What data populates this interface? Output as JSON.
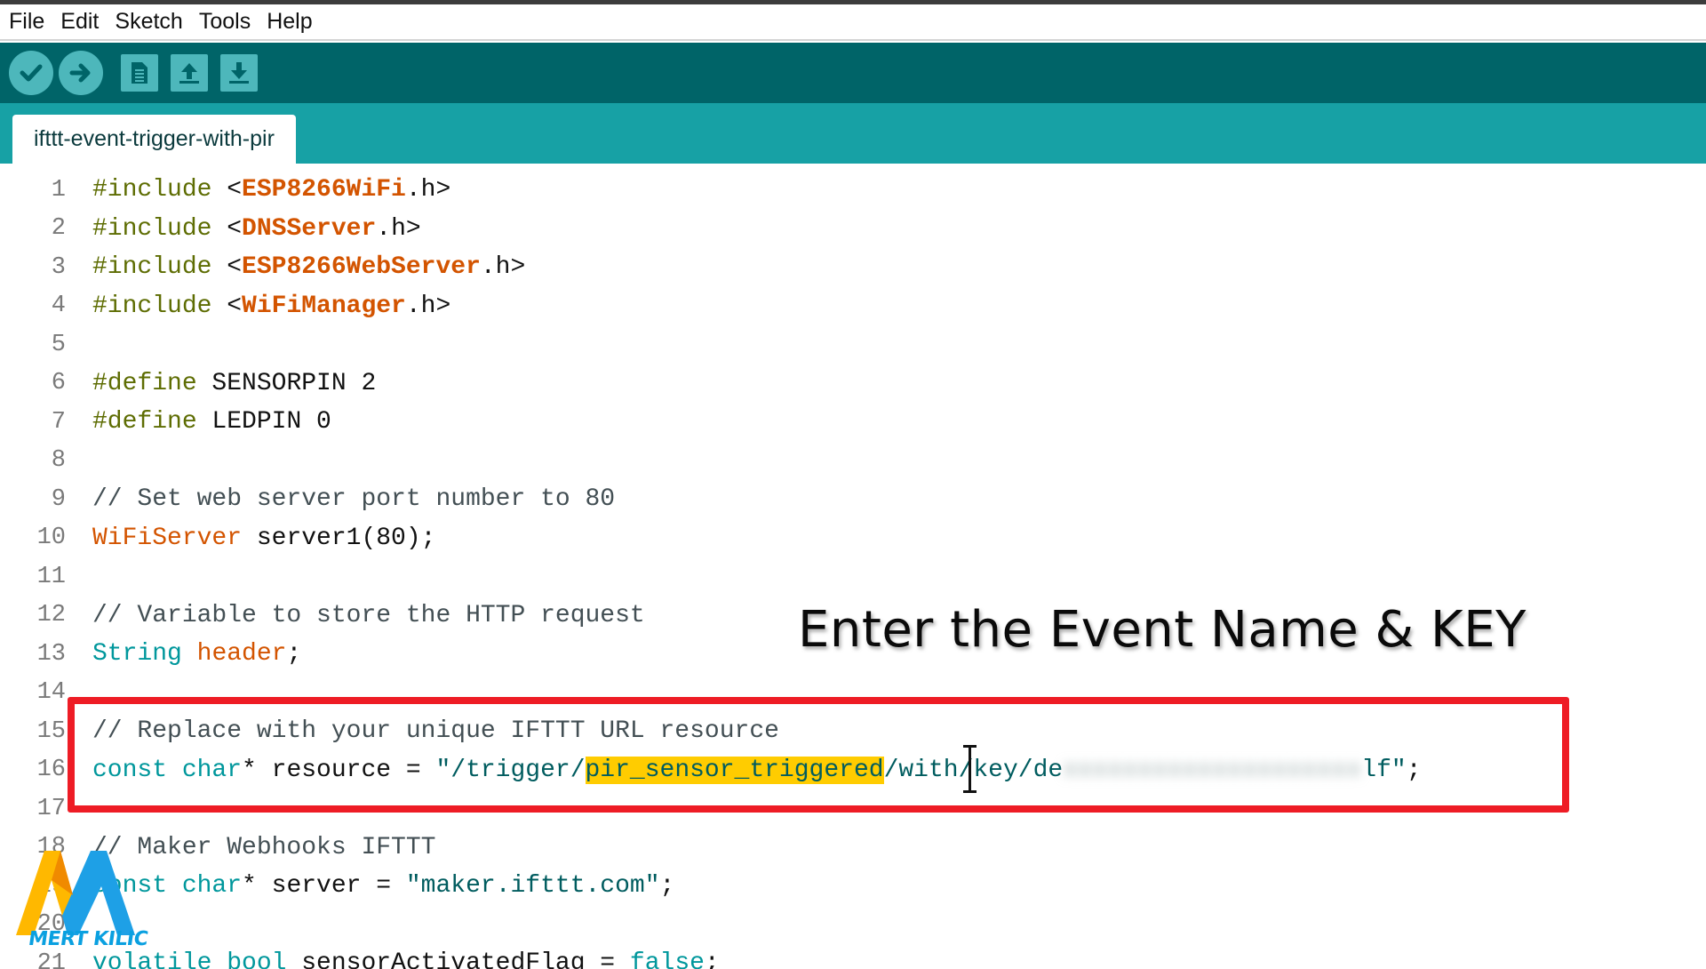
{
  "menu": [
    "File",
    "Edit",
    "Sketch",
    "Tools",
    "Help"
  ],
  "toolbar": {
    "verify_icon": "check-icon",
    "upload_icon": "arrow-right-icon",
    "new_icon": "new-file-icon",
    "open_icon": "open-arrow-up-icon",
    "save_icon": "save-arrow-down-icon"
  },
  "tab": {
    "label": "ifttt-event-trigger-with-pir"
  },
  "lines": {
    "l1": {
      "n": "1",
      "kw": "#include",
      "sp": " <",
      "lib": "ESP8266WiFi",
      "rest": ".h>"
    },
    "l2": {
      "n": "2",
      "kw": "#include",
      "sp": " <",
      "lib": "DNSServer",
      "rest": ".h>"
    },
    "l3": {
      "n": "3",
      "kw": "#include",
      "sp": " <",
      "lib": "ESP8266WebServer",
      "rest": ".h>"
    },
    "l4": {
      "n": "4",
      "kw": "#include",
      "sp": " <",
      "lib": "WiFiManager",
      "rest": ".h>"
    },
    "l5": {
      "n": "5"
    },
    "l6": {
      "n": "6",
      "kw": "#define",
      "rest": " SENSORPIN 2"
    },
    "l7": {
      "n": "7",
      "kw": "#define",
      "rest": " LEDPIN 0"
    },
    "l8": {
      "n": "8"
    },
    "l9": {
      "n": "9",
      "cmt": "// Set web server port number to 80"
    },
    "l10": {
      "n": "10",
      "cls": "WiFiServer",
      "rest": " server1(80);"
    },
    "l11": {
      "n": "11"
    },
    "l12": {
      "n": "12",
      "cmt": "// Variable to store the HTTP request"
    },
    "l13": {
      "n": "13",
      "type": "String",
      "sp": " ",
      "cls": "header",
      "rest": ";"
    },
    "l14": {
      "n": "14"
    },
    "l15": {
      "n": "15",
      "cmt": "// Replace with your unique IFTTT URL resource"
    },
    "l16": {
      "n": "16",
      "type": "const char",
      "a": "* resource = ",
      "s1": "\"/trigger/",
      "hl": "pir_sensor_triggered",
      "s2": "/with/key/de",
      "blur": "xxxxxxxxxxxxxxxxxxxx",
      "s3": "lf\"",
      "end": ";"
    },
    "l17": {
      "n": "17"
    },
    "l18": {
      "n": "18",
      "cmt": "// Maker Webhooks IFTTT"
    },
    "l19": {
      "n": "19",
      "type": "const char",
      "a": "* server = ",
      "s1": "\"maker.ifttt.com\"",
      "end": ";"
    },
    "l20": {
      "n": "20"
    },
    "l21": {
      "n": "21",
      "type": "volatile bool",
      "a": " sensorActivatedFlag = ",
      "kwf": "false",
      "end": ";"
    }
  },
  "annotation": "Enter the Event Name & KEY",
  "logo": {
    "text": "MERT KILIC",
    "colors": [
      "#ffb800",
      "#1ea0e6"
    ]
  },
  "colors": {
    "toolbar": "#006468",
    "tabbar": "#17a1a5",
    "button": "#4db7bb",
    "highlight_box": "#ee1c25",
    "selection": "#ffcc00"
  }
}
